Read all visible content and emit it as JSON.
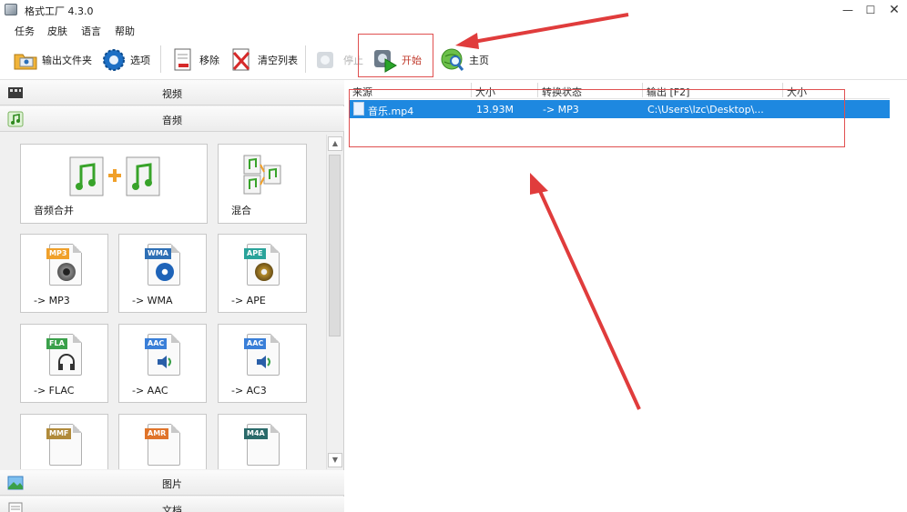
{
  "window": {
    "title": "格式工厂 4.3.0",
    "minimize": "—",
    "maximize": "☐",
    "close": "✕"
  },
  "menu": [
    "任务",
    "皮肤",
    "语言",
    "帮助"
  ],
  "toolbar": {
    "output_folder": "输出文件夹",
    "options": "选项",
    "remove": "移除",
    "clear_list": "清空列表",
    "stop": "停止",
    "start": "开始",
    "home": "主页"
  },
  "categories": {
    "video": "视频",
    "audio": "音频",
    "picture": "图片",
    "document": "文档"
  },
  "tiles": {
    "merge": "音频合并",
    "mix": "混合",
    "mp3": "-> MP3",
    "wma": "-> WMA",
    "ape": "-> APE",
    "flac": "-> FLAC",
    "aac": "-> AAC",
    "ac3": "-> AC3"
  },
  "badges": {
    "mp3": "MP3",
    "wma": "WMA",
    "ape": "APE",
    "fla": "FLA",
    "aac": "AAC",
    "aac2": "AAC",
    "mmf": "MMF",
    "amr": "AMR",
    "m4a": "M4A"
  },
  "grid": {
    "columns": [
      "来源",
      "大小",
      "转换状态",
      "输出 [F2]",
      "大小"
    ],
    "rows": [
      {
        "source": "音乐.mp4",
        "size": "13.93M",
        "status": "-> MP3",
        "output": "C:\\Users\\lzc\\Desktop\\...",
        "out_size": ""
      }
    ]
  },
  "colors": {
    "selection": "#1e88e0",
    "annotation": "#e03c3c"
  }
}
